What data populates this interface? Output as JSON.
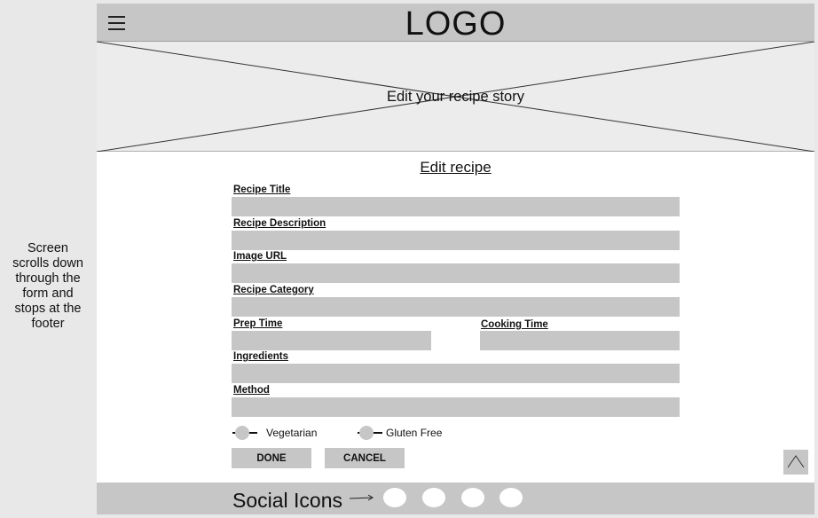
{
  "annotation": {
    "lines": [
      "Screen",
      "scrolls down",
      "through the",
      "form and",
      "stops at the",
      "footer"
    ]
  },
  "header": {
    "logo": "LOGO",
    "menu_icon": "hamburger-menu-icon"
  },
  "hero": {
    "text": "Edit your recipe story",
    "image_placeholder_icon": "image-placeholder-icon"
  },
  "form": {
    "title": "Edit recipe",
    "recipe_title": {
      "label": "Recipe Title",
      "value": ""
    },
    "recipe_description": {
      "label": "Recipe Description",
      "value": ""
    },
    "image_url": {
      "label": "Image URL",
      "value": ""
    },
    "recipe_category": {
      "label": "Recipe Category",
      "value": ""
    },
    "prep_time": {
      "label": "Prep Time",
      "value": ""
    },
    "cooking_time": {
      "label": "Cooking Time",
      "value": ""
    },
    "ingredients": {
      "label": "Ingredients",
      "value": ""
    },
    "method": {
      "label": "Method",
      "value": ""
    },
    "vegetarian": {
      "label": "Vegetarian",
      "on": false
    },
    "gluten_free": {
      "label": "Gluten Free",
      "on": false
    },
    "done_label": "DONE",
    "cancel_label": "CANCEL"
  },
  "scroll_to_top_icon": "chevron-up-icon",
  "footer": {
    "social_text": "Social Icons",
    "arrow_icon": "arrow-right-icon",
    "social_icon_count": 4
  },
  "colors": {
    "placeholder_gray": "#c6c6c6",
    "page_background": "#e8e8e8",
    "content_background": "#ffffff"
  }
}
